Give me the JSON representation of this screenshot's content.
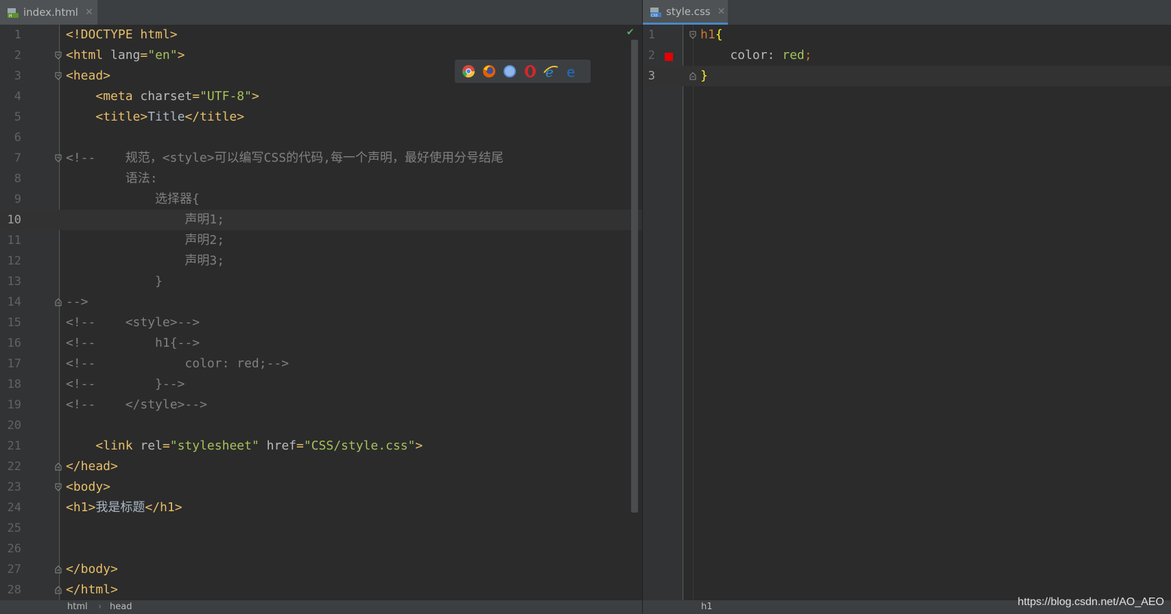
{
  "left_tab": {
    "label": "index.html",
    "close": "✕"
  },
  "right_tab": {
    "label": "style.css",
    "close": "✕"
  },
  "left_lines": [
    {
      "n": "1",
      "parts": [
        [
          "t-tag",
          "<!DOCTYPE html>"
        ]
      ]
    },
    {
      "n": "2",
      "parts": [
        [
          "t-tag",
          "<html "
        ],
        [
          "t-attr",
          "lang"
        ],
        [
          "t-tag",
          "="
        ],
        [
          "t-val",
          "\"en\""
        ],
        [
          "t-tag",
          ">"
        ]
      ]
    },
    {
      "n": "3",
      "parts": [
        [
          "t-tag",
          "<head>"
        ]
      ]
    },
    {
      "n": "4",
      "parts": [
        [
          "t-txt",
          "    "
        ],
        [
          "t-tag",
          "<meta "
        ],
        [
          "t-attr",
          "charset"
        ],
        [
          "t-tag",
          "="
        ],
        [
          "t-val",
          "\"UTF-8\""
        ],
        [
          "t-tag",
          ">"
        ]
      ]
    },
    {
      "n": "5",
      "parts": [
        [
          "t-txt",
          "    "
        ],
        [
          "t-tag",
          "<title>"
        ],
        [
          "t-txt",
          "Title"
        ],
        [
          "t-tag",
          "</title>"
        ]
      ]
    },
    {
      "n": "6",
      "parts": []
    },
    {
      "n": "7",
      "parts": [
        [
          "t-com",
          "<!--    规范，<style>可以编写CSS的代码,每一个声明，最好使用分号结尾"
        ]
      ]
    },
    {
      "n": "8",
      "parts": [
        [
          "t-com",
          "        语法:"
        ]
      ]
    },
    {
      "n": "9",
      "parts": [
        [
          "t-com",
          "            选择器{"
        ]
      ]
    },
    {
      "n": "10",
      "parts": [
        [
          "t-com",
          "                声明1;"
        ]
      ]
    },
    {
      "n": "11",
      "parts": [
        [
          "t-com",
          "                声明2;"
        ]
      ]
    },
    {
      "n": "12",
      "parts": [
        [
          "t-com",
          "                声明3;"
        ]
      ]
    },
    {
      "n": "13",
      "parts": [
        [
          "t-com",
          "            }"
        ]
      ]
    },
    {
      "n": "14",
      "parts": [
        [
          "t-com",
          "-->"
        ]
      ]
    },
    {
      "n": "15",
      "parts": [
        [
          "t-com",
          "<!--    <style>-->"
        ]
      ]
    },
    {
      "n": "16",
      "parts": [
        [
          "t-com",
          "<!--        h1{-->"
        ]
      ]
    },
    {
      "n": "17",
      "parts": [
        [
          "t-com",
          "<!--            color: red;-->"
        ]
      ]
    },
    {
      "n": "18",
      "parts": [
        [
          "t-com",
          "<!--        }-->"
        ]
      ]
    },
    {
      "n": "19",
      "parts": [
        [
          "t-com",
          "<!--    </style>-->"
        ]
      ]
    },
    {
      "n": "20",
      "parts": []
    },
    {
      "n": "21",
      "parts": [
        [
          "t-txt",
          "    "
        ],
        [
          "t-tag",
          "<link "
        ],
        [
          "t-attr",
          "rel"
        ],
        [
          "t-tag",
          "="
        ],
        [
          "t-val",
          "\"stylesheet\""
        ],
        [
          "t-tag",
          " "
        ],
        [
          "t-attr",
          "href"
        ],
        [
          "t-tag",
          "="
        ],
        [
          "t-val",
          "\"CSS/style.css\""
        ],
        [
          "t-tag",
          ">"
        ]
      ]
    },
    {
      "n": "22",
      "parts": [
        [
          "t-tag",
          "</head>"
        ]
      ]
    },
    {
      "n": "23",
      "parts": [
        [
          "t-tag",
          "<body>"
        ]
      ]
    },
    {
      "n": "24",
      "parts": [
        [
          "t-tag",
          "<h1>"
        ],
        [
          "t-txt",
          "我是标题"
        ],
        [
          "t-tag",
          "</h1>"
        ]
      ]
    },
    {
      "n": "25",
      "parts": []
    },
    {
      "n": "26",
      "parts": []
    },
    {
      "n": "27",
      "parts": [
        [
          "t-tag",
          "</body>"
        ]
      ]
    },
    {
      "n": "28",
      "parts": [
        [
          "t-tag",
          "</html>"
        ]
      ]
    }
  ],
  "right_lines": [
    {
      "n": "1",
      "parts": [
        [
          "t-sel",
          "h1"
        ],
        [
          "t-brace",
          "{"
        ]
      ]
    },
    {
      "n": "2",
      "parts": [
        [
          "t-prop",
          "    color"
        ],
        [
          "t-txt",
          ": "
        ],
        [
          "t-cssval",
          "red"
        ],
        [
          "t-semi",
          ";"
        ]
      ]
    },
    {
      "n": "3",
      "parts": [
        [
          "t-brace",
          "}"
        ]
      ]
    }
  ],
  "browser_icons": [
    "chrome-icon",
    "firefox-icon",
    "safari-icon",
    "opera-icon",
    "ie-icon",
    "edge-icon"
  ],
  "status_left": {
    "crumb1": "html",
    "crumb_sep": "›",
    "crumb2": "head"
  },
  "status_right": {
    "crumb1": "h1"
  },
  "watermark": "https://blog.csdn.net/AO_AEO",
  "colors": {
    "error_mark": "#e60000",
    "check": "#59a869"
  }
}
